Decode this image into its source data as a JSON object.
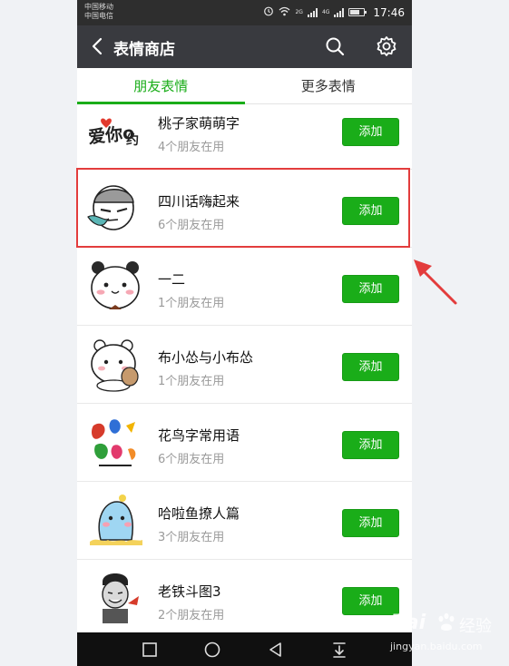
{
  "status_bar": {
    "carrier_1": "中国移动",
    "carrier_2": "中国电信",
    "time": "17:46",
    "network_1": "2G",
    "network_2": "4G"
  },
  "nav": {
    "title": "表情商店",
    "back_icon": "back-chevron-icon",
    "search_icon": "search-icon",
    "settings_icon": "gear-icon"
  },
  "tabs": [
    {
      "label": "朋友表情",
      "active": true
    },
    {
      "label": "更多表情",
      "active": false
    }
  ],
  "stickers": [
    {
      "name": "桃子家萌萌字",
      "count": "4个朋友在用",
      "button": "添加",
      "thumb": "love-text-sticker"
    },
    {
      "name": "四川话嗨起来",
      "count": "6个朋友在用",
      "button": "添加",
      "thumb": "grumpy-face-sticker"
    },
    {
      "name": "一二",
      "count": "1个朋友在用",
      "button": "添加",
      "thumb": "panda-bear-sticker"
    },
    {
      "name": "布小怂与小布怂",
      "count": "1个朋友在用",
      "button": "添加",
      "thumb": "white-bear-sticker"
    },
    {
      "name": "花鸟字常用语",
      "count": "6个朋友在用",
      "button": "添加",
      "thumb": "flower-bird-text-sticker"
    },
    {
      "name": "哈啦鱼撩人篇",
      "count": "3个朋友在用",
      "button": "添加",
      "thumb": "blue-fish-sticker"
    },
    {
      "name": "老铁斗图3",
      "count": "2个朋友在用",
      "button": "添加",
      "thumb": "meme-face-sticker"
    }
  ],
  "watermark": {
    "brand": "Bai",
    "brand_cn": "经验",
    "domain": "jingyan.baidu.com"
  },
  "colors": {
    "accent": "#1aad19",
    "highlight": "#e33c3c",
    "navbar": "#393a3f",
    "statusbar": "#2e2e2e"
  }
}
